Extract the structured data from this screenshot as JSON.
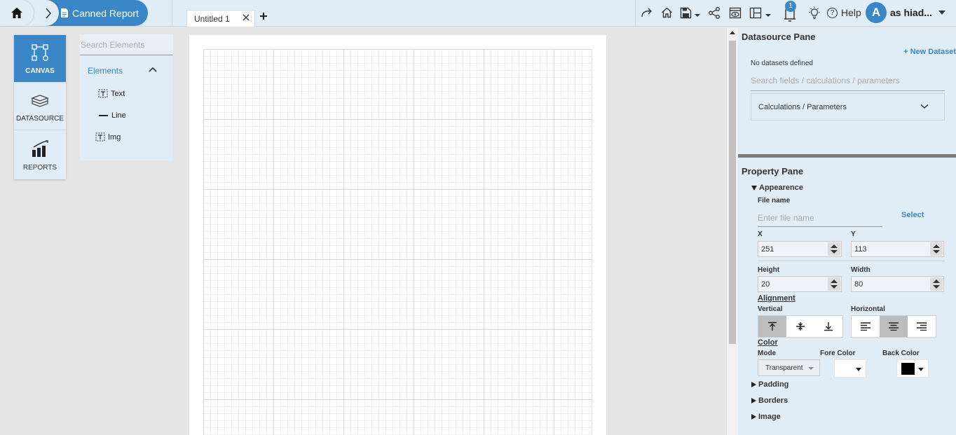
{
  "topbar": {
    "breadcrumb_label": "Canned Report",
    "tab_label": "Untitled 1",
    "notification_count": "1",
    "help_label": "Help",
    "avatar_initial": "A",
    "user_name": "as hiad..."
  },
  "leftnav": {
    "items": [
      {
        "label": "CANVAS",
        "icon": "canvas-icon",
        "active": true
      },
      {
        "label": "DATASOURCE",
        "icon": "database-icon",
        "active": false
      },
      {
        "label": "REPORTS",
        "icon": "bar-chart-icon",
        "active": false
      }
    ]
  },
  "elements": {
    "search_placeholder": "Search Elements",
    "header": "Elements",
    "items": [
      {
        "label": "Text",
        "icon": "text-element-icon"
      },
      {
        "label": "Line",
        "icon": "line-element-icon"
      },
      {
        "label": "Img",
        "icon": "image-element-icon"
      }
    ]
  },
  "datasource": {
    "title": "Datasource Pane",
    "new_dataset": "+ New Dataset",
    "empty_message": "No datasets defined",
    "search_placeholder": "Search fields / calculations / parameters",
    "calc_label": "Calculations / Parameters"
  },
  "property": {
    "title": "Property Pane",
    "appearance": "Appearence",
    "file_name_label": "File name",
    "file_name_placeholder": "Enter file name",
    "select_label": "Select",
    "x_label": "X",
    "x_value": "251",
    "y_label": "Y",
    "y_value": "113",
    "height_label": "Height",
    "height_value": "20",
    "width_label": "Width",
    "width_value": "80",
    "alignment_label": "Alignment",
    "vertical_label": "Vertical",
    "horizontal_label": "Horizontal",
    "vertical_selected": "top",
    "horizontal_selected": "center",
    "color_label": "Color",
    "mode_label": "Mode",
    "mode_value": "Transparent",
    "fore_color_label": "Fore Color",
    "fore_color": "#ffffff",
    "back_color_label": "Back Color",
    "back_color": "#000000",
    "sections": [
      "Padding",
      "Borders",
      "Image"
    ]
  },
  "colors": {
    "accent": "#3a86c6",
    "panel_bg": "#e0edf7"
  }
}
